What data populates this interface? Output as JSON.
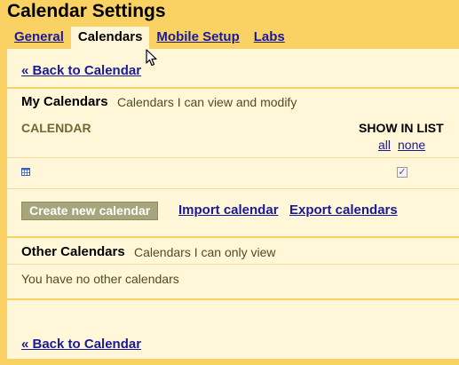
{
  "page": {
    "title": "Calendar Settings"
  },
  "tabs": [
    {
      "label": "General",
      "active": false
    },
    {
      "label": "Calendars",
      "active": true
    },
    {
      "label": "Mobile Setup",
      "active": false
    },
    {
      "label": "Labs",
      "active": false
    }
  ],
  "back_link_top": "« Back to Calendar",
  "my_calendars": {
    "title": "My Calendars",
    "subtitle": "Calendars I can view and modify",
    "col_calendar": "CALENDAR",
    "col_show_in_list": "SHOW IN LIST",
    "select_all": "all",
    "select_none": "none",
    "rows": [
      {
        "name": "",
        "show_in_list": true,
        "icon": "calendar-icon"
      }
    ]
  },
  "actions": {
    "create": "Create new calendar",
    "import": "Import calendar",
    "export": "Export calendars"
  },
  "other_calendars": {
    "title": "Other Calendars",
    "subtitle": "Calendars I can only view",
    "empty_message": "You have no other calendars"
  },
  "back_link_bottom": "« Back to Calendar",
  "colors": {
    "background": "#fad163",
    "panel": "#fff7d7",
    "link": "#1a1a99",
    "button": "#a7a57c"
  }
}
